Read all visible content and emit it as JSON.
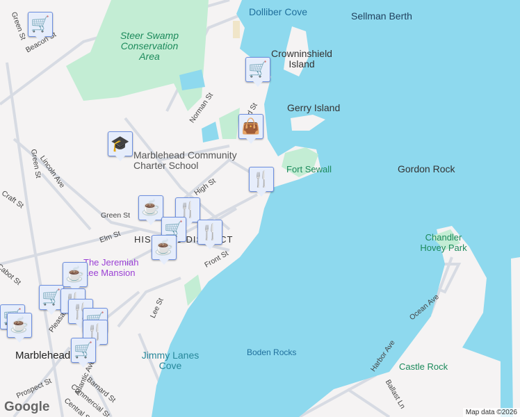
{
  "colors": {
    "water": "#8ed9ee",
    "land": "#f5f3f3",
    "park": "#c3edd4",
    "road": "#d7dbe3",
    "marker": "#0b3c61"
  },
  "labels": {
    "water": [
      "Dolliber Cove",
      "Sellman Berth",
      "Boden Rocks",
      "Jimmy Lanes Cove"
    ],
    "islands": [
      "Crowninshield Island",
      "Gerry Island",
      "Gordon Rock",
      "Castle Rock"
    ],
    "parks": [
      "Steer Swamp Conservation Area",
      "Fort Sewall",
      "Chandler Hovey Park"
    ],
    "poi": [
      "Marblehead Community Charter School",
      "The Jeremiah Lee Mansion",
      "HISTORIC DISTRICT"
    ],
    "town": "Marblehead",
    "roads": [
      "Green St",
      "Green St",
      "Green St",
      "Norman St",
      "High St",
      "Lincoln Ave",
      "Elm St",
      "Front St",
      "Lee St",
      "Ocean Ave",
      "Harbor Ave",
      "Ballast Ln",
      "Prospect St",
      "Barnard St",
      "Commercial St",
      "Central St",
      "Atlantic Ave",
      "Pleasant St",
      "Cabot St",
      "Beacon St",
      "Pond St",
      "Craft St"
    ]
  },
  "markers": [
    {
      "type": "grocery",
      "icon": "cart-icon"
    },
    {
      "type": "grocery",
      "icon": "cart-icon"
    },
    {
      "type": "shopping",
      "icon": "bag-icon"
    },
    {
      "type": "restaurant",
      "icon": "fork-knife-icon"
    },
    {
      "type": "school",
      "icon": "graduation-cap-icon"
    },
    {
      "type": "cafe",
      "icon": "coffee-icon"
    },
    {
      "type": "restaurant",
      "icon": "fork-knife-icon"
    },
    {
      "type": "restaurant",
      "icon": "fork-knife-icon"
    },
    {
      "type": "cafe",
      "icon": "coffee-icon"
    },
    {
      "type": "cafe",
      "icon": "coffee-icon"
    },
    {
      "type": "grocery",
      "icon": "cart-icon"
    },
    {
      "type": "restaurant",
      "icon": "fork-knife-icon"
    },
    {
      "type": "grocery",
      "icon": "cart-icon"
    },
    {
      "type": "cafe",
      "icon": "coffee-icon"
    },
    {
      "type": "restaurant",
      "icon": "fork-knife-icon"
    },
    {
      "type": "grocery",
      "icon": "cart-icon"
    }
  ],
  "attribution": "Map data ©2026",
  "google_logo": "Google"
}
